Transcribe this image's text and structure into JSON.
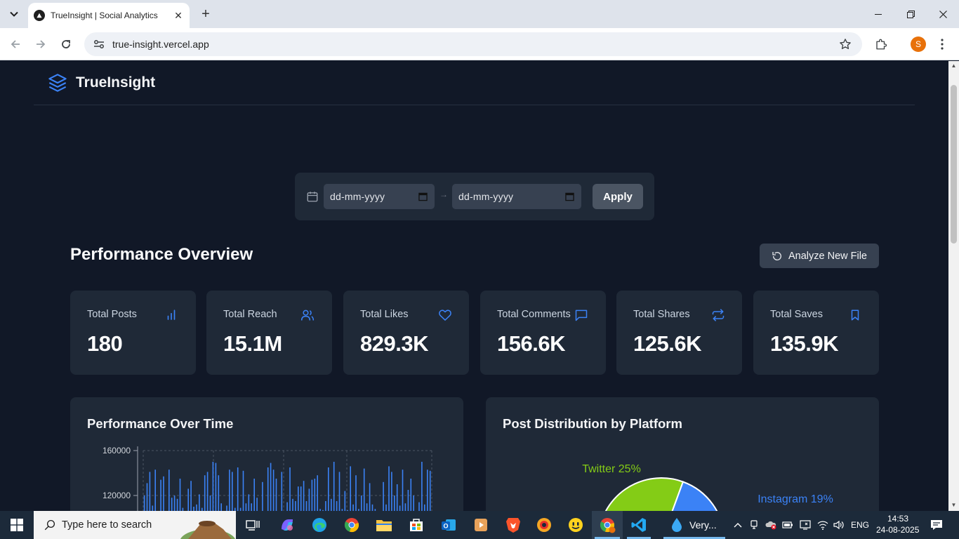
{
  "browser": {
    "tab_title": "TrueInsight | Social Analytics",
    "url": "true-insight.vercel.app",
    "profile_initial": "S"
  },
  "app": {
    "brand": "TrueInsight",
    "accent_color": "#3b82f6",
    "date_from_placeholder": "dd-mm-yyyy",
    "date_to_placeholder": "dd-mm-yyyy",
    "apply_label": "Apply",
    "section_title": "Performance Overview",
    "analyze_label": "Analyze New File",
    "stats": [
      {
        "label": "Total Posts",
        "value": "180",
        "icon": "bar-chart-icon"
      },
      {
        "label": "Total Reach",
        "value": "15.1M",
        "icon": "users-icon"
      },
      {
        "label": "Total Likes",
        "value": "829.3K",
        "icon": "heart-icon"
      },
      {
        "label": "Total Comments",
        "value": "156.6K",
        "icon": "comment-icon"
      },
      {
        "label": "Total Shares",
        "value": "125.6K",
        "icon": "repeat-icon"
      },
      {
        "label": "Total Saves",
        "value": "135.9K",
        "icon": "bookmark-icon"
      }
    ],
    "performance_panel_title": "Performance Over Time",
    "distribution_panel_title": "Post Distribution by Platform"
  },
  "chart_data": [
    {
      "type": "bar",
      "title": "Performance Over Time",
      "y_ticks": [
        "160000",
        "120000"
      ],
      "ylim": [
        100000,
        160000
      ],
      "grid": true,
      "color": "#3b82f6",
      "values": [
        120000,
        131000,
        141000,
        111000,
        143000,
        103000,
        134000,
        137000,
        106000,
        143000,
        118000,
        120000,
        117000,
        135000,
        109000,
        103000,
        126000,
        133000,
        110000,
        112000,
        121000,
        109000,
        138000,
        141000,
        120000,
        150000,
        149000,
        138000,
        113000,
        106000,
        111000,
        143000,
        141000,
        109000,
        145000,
        109000,
        142000,
        113000,
        121000,
        113000,
        135000,
        118000,
        106000,
        132000,
        103000,
        145000,
        149000,
        143000,
        135000,
        106000,
        141000,
        106000,
        114000,
        145000,
        117000,
        115000,
        128000,
        128000,
        133000,
        115000,
        126000,
        134000,
        135000,
        138000,
        108000,
        107000,
        115000,
        145000,
        117000,
        150000,
        115000,
        141000,
        108000,
        124000,
        107000,
        146000,
        112000,
        138000,
        108000,
        120000,
        144000,
        113000,
        131000,
        112000,
        108000,
        103000,
        105000,
        132000,
        112000,
        146000,
        141000,
        120000,
        130000,
        111000,
        143000,
        113000,
        125000,
        135000,
        120000,
        104000,
        114000,
        150000,
        112000,
        143000,
        142000
      ]
    },
    {
      "type": "pie",
      "title": "Post Distribution by Platform",
      "slices": [
        {
          "label": "Twitter",
          "value": 25,
          "display": "Twitter 25%",
          "color": "#84cc16"
        },
        {
          "label": "Instagram",
          "value": 19,
          "display": "Instagram 19%",
          "color": "#3b82f6"
        }
      ]
    }
  ],
  "taskbar": {
    "search_placeholder": "Type here to search",
    "vpn_label": "Very...",
    "language": "ENG",
    "time": "14:53",
    "date": "24-08-2025"
  }
}
